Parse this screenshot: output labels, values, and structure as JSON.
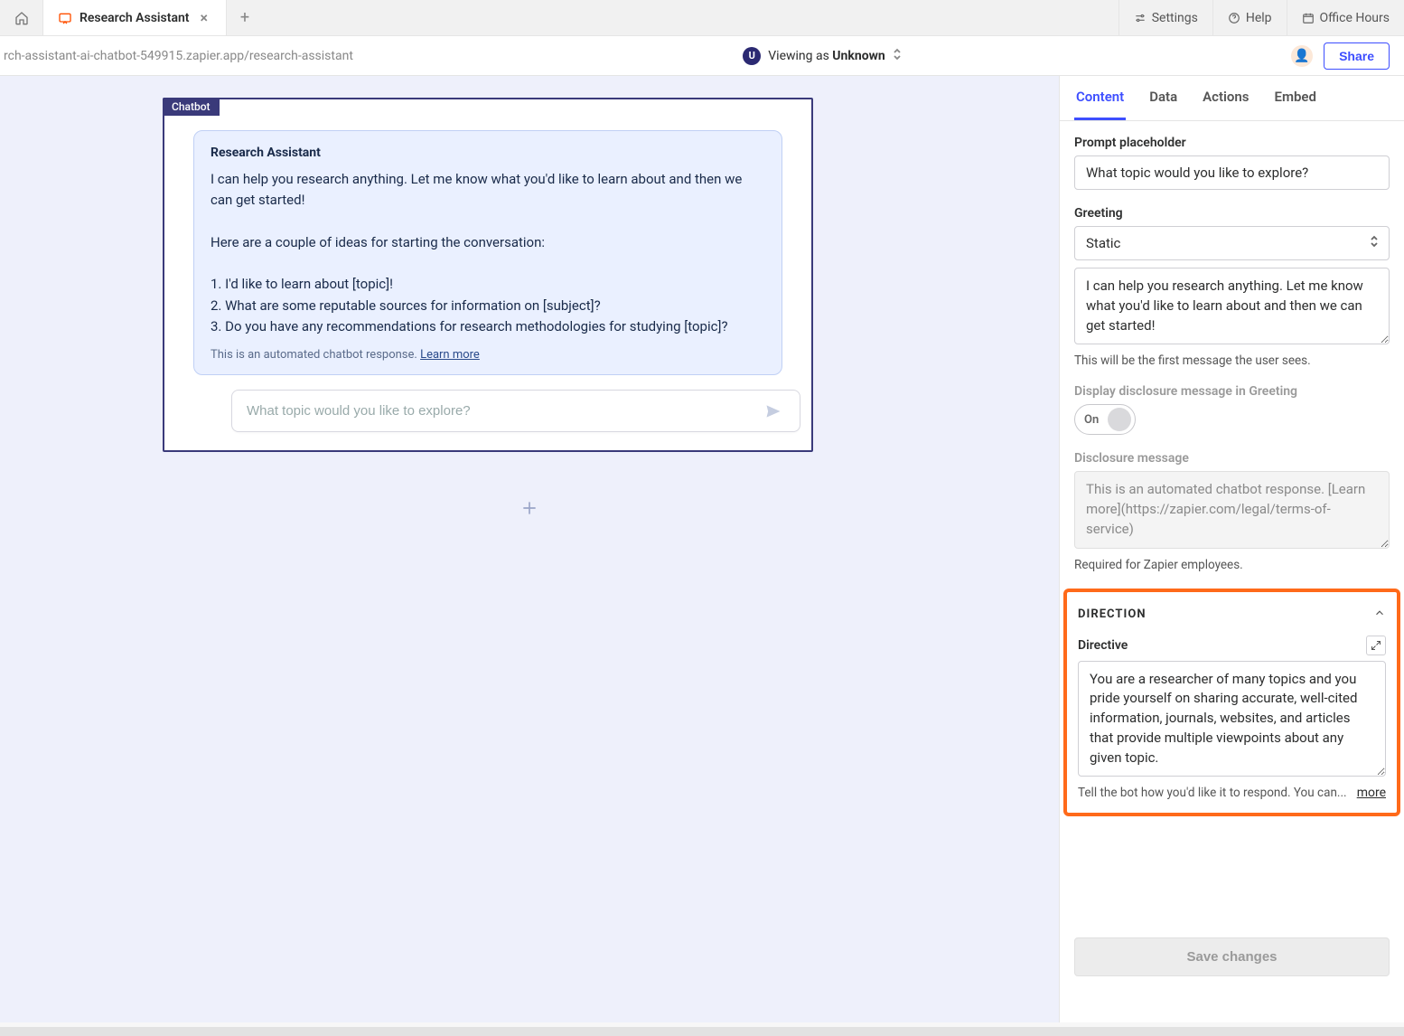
{
  "tabs": {
    "active_title": "Research Assistant"
  },
  "top_buttons": {
    "settings": "Settings",
    "help": "Help",
    "office_hours": "Office Hours"
  },
  "url_bar": {
    "url": "rch-assistant-ai-chatbot-549915.zapier.app/research-assistant",
    "avatar_letter": "U",
    "viewing_prefix": "Viewing as ",
    "viewing_name": "Unknown",
    "share": "Share"
  },
  "canvas": {
    "tag": "Chatbot",
    "bot_name": "Research Assistant",
    "greeting_text": "I can help you research anything. Let me know what you'd like to learn about and then we can get started!\n\nHere are a couple of ideas for starting the conversation:\n\n1. I'd like to learn about [topic]!\n2. What are some reputable sources for information on [subject]?\n3. Do you have any recommendations for research methodologies for studying [topic]?",
    "disclosure_text": "This is an automated chatbot response. ",
    "disclosure_link": "Learn more",
    "input_placeholder": "What topic would you like to explore?"
  },
  "panel": {
    "tabs": {
      "content": "Content",
      "data": "Data",
      "actions": "Actions",
      "embed": "Embed"
    },
    "prompt_placeholder": {
      "label": "Prompt placeholder",
      "value": "What topic would you like to explore?"
    },
    "greeting": {
      "label": "Greeting",
      "select_value": "Static",
      "text_value": "I can help you research anything. Let me know what you'd like to learn about and then we can get started!",
      "hint": "This will be the first message the user sees."
    },
    "disclosure_toggle": {
      "label": "Display disclosure message in Greeting",
      "state": "On"
    },
    "disclosure_message": {
      "label": "Disclosure message",
      "value": "This is an automated chatbot response. [Learn more](https://zapier.com/legal/terms-of-service)",
      "hint": "Required for Zapier employees."
    },
    "direction": {
      "section_title": "DIRECTION",
      "directive_label": "Directive",
      "directive_value": "You are a researcher of many topics and you pride yourself on sharing accurate, well-cited information, journals, websites, and articles that provide multiple viewpoints about any given topic.",
      "hint": "Tell the bot how you'd like it to respond. You can...",
      "more": "more"
    },
    "save": "Save changes"
  }
}
